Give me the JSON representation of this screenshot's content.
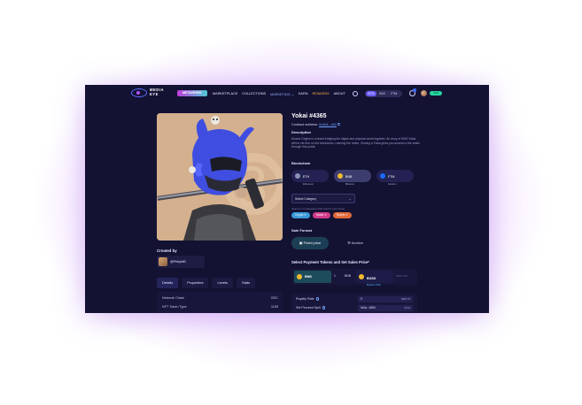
{
  "nav": {
    "logo_line1": "MEDIA",
    "logo_line2": "EYE",
    "metaverse": "METAVERSE",
    "links": [
      "MARKETPLACE",
      "COLLECTIONS",
      "MARKETING ⌄",
      "EARN",
      "REWARDS",
      "ABOUT"
    ],
    "chains": [
      "ETH",
      "BSC",
      "FTM"
    ],
    "active_chain": "ETH",
    "balance": "0.00"
  },
  "nft": {
    "title": "Yokai #4365",
    "contract_label": "Contract address:",
    "contract_value": "0x3e5...d92",
    "description_label": "Description",
    "description": "Akuma Origins is a brand bridging the digital and physical world together. An army of 5000 Yokai will be set free on the blockchain, roaming the realm. Owning a Yokai gives you access to the realm through this portal."
  },
  "created": {
    "label": "Created by",
    "name": "@Petrykit0"
  },
  "tabs": [
    "Details",
    "Properties",
    "Levels",
    "Stats"
  ],
  "details": [
    {
      "label": "Network Chain",
      "value": "BSC"
    },
    {
      "label": "NFT Token Type",
      "value": "1155"
    }
  ],
  "blockchain": {
    "label": "Blockchain",
    "options": [
      {
        "name": "ETH",
        "sub": "Ethereum",
        "color": "#8a92b2"
      },
      {
        "name": "BNB",
        "sub": "Binance",
        "color": "#f3ba2f"
      },
      {
        "name": "FTM",
        "sub": "Fantom",
        "color": "#1969ff"
      }
    ],
    "selected": "BNB"
  },
  "category": {
    "placeholder": "Select Category",
    "hint": "Search 1-3 categories that best fit your listing",
    "tags": [
      {
        "label": "Crypto ✕",
        "color": "#3a9ad9"
      },
      {
        "label": "Music ✕",
        "color": "#d13b8a"
      },
      {
        "label": "Sports ✕",
        "color": "#e06a3a"
      }
    ]
  },
  "sale": {
    "label": "Sale Format",
    "fixed": "Fixed price",
    "auction": "Auction"
  },
  "payment": {
    "label": "Select Payment Tokens and Set Sales Price*",
    "bnb_label": "BNB",
    "bnb_amount": "1",
    "bnb_unit": "BNB",
    "busd_label": "BUSD",
    "busd_sub": "Binance USD",
    "extra": "BNB USD"
  },
  "fees": {
    "royalty_label": "Royalty Rate",
    "royalty_value": "0",
    "royalty_unit": "MAX  %",
    "split_label": "Set Proceed Split",
    "split_value": "0x2a...3454",
    "split_unit": "10  %"
  }
}
